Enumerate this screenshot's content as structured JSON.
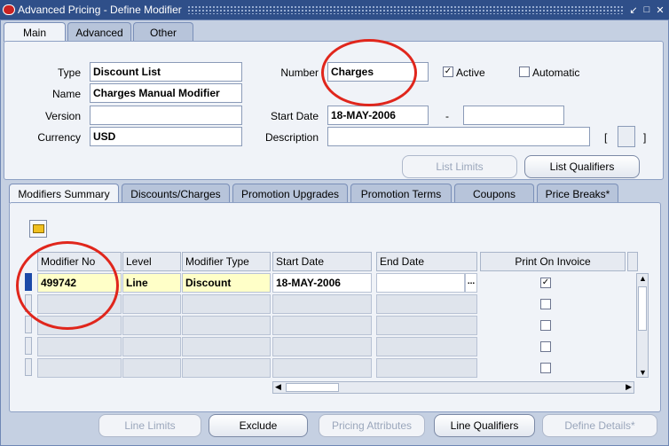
{
  "window": {
    "title": "Advanced Pricing - Define Modifier"
  },
  "top_tabs": [
    {
      "label": "Main"
    },
    {
      "label": "Advanced"
    },
    {
      "label": "Other"
    }
  ],
  "header": {
    "type_label": "Type",
    "type_value": "Discount List",
    "name_label": "Name",
    "name_value": "Charges Manual Modifier",
    "version_label": "Version",
    "version_value": "",
    "currency_label": "Currency",
    "currency_value": "USD",
    "number_label": "Number",
    "number_value": "Charges",
    "active_label": "Active",
    "active_checked": true,
    "automatic_label": "Automatic",
    "automatic_checked": false,
    "start_date_label": "Start Date",
    "start_date_value": "18-MAY-2006",
    "date_separator": "-",
    "end_date_value": "",
    "description_label": "Description",
    "description_value": "",
    "bracket_open": "[",
    "bracket_close": "]"
  },
  "header_buttons": {
    "list_limits": "List Limits",
    "list_qualifiers": "List Qualifiers"
  },
  "lower_tabs": [
    {
      "label": "Modifiers Summary"
    },
    {
      "label": "Discounts/Charges"
    },
    {
      "label": "Promotion Upgrades"
    },
    {
      "label": "Promotion Terms"
    },
    {
      "label": "Coupons"
    },
    {
      "label": "Price Breaks*"
    }
  ],
  "table": {
    "columns": [
      "Modifier No",
      "Level",
      "Modifier Type",
      "Start Date",
      "End Date",
      "Print On Invoice"
    ],
    "rows": [
      {
        "modifier_no": "499742",
        "level": "Line",
        "modifier_type": "Discount",
        "start_date": "18-MAY-2006",
        "end_date": "",
        "print_on_invoice": true
      },
      {
        "modifier_no": "",
        "level": "",
        "modifier_type": "",
        "start_date": "",
        "end_date": "",
        "print_on_invoice": false
      },
      {
        "modifier_no": "",
        "level": "",
        "modifier_type": "",
        "start_date": "",
        "end_date": "",
        "print_on_invoice": false
      },
      {
        "modifier_no": "",
        "level": "",
        "modifier_type": "",
        "start_date": "",
        "end_date": "",
        "print_on_invoice": false
      },
      {
        "modifier_no": "",
        "level": "",
        "modifier_type": "",
        "start_date": "",
        "end_date": "",
        "print_on_invoice": false
      }
    ],
    "ellipsis": "..."
  },
  "bottom_buttons": {
    "line_limits": "Line Limits",
    "exclude": "Exclude",
    "pricing_attributes": "Pricing Attributes",
    "line_qualifiers": "Line Qualifiers",
    "define_details": "Define Details*"
  },
  "icons": [
    "app-icon",
    "folder-icon",
    "minimize-icon",
    "maximize-icon",
    "close-icon"
  ],
  "colors": {
    "titlebar": "#2f4f89",
    "annotation": "#e0261c",
    "yellow_field": "#ffffc8"
  }
}
